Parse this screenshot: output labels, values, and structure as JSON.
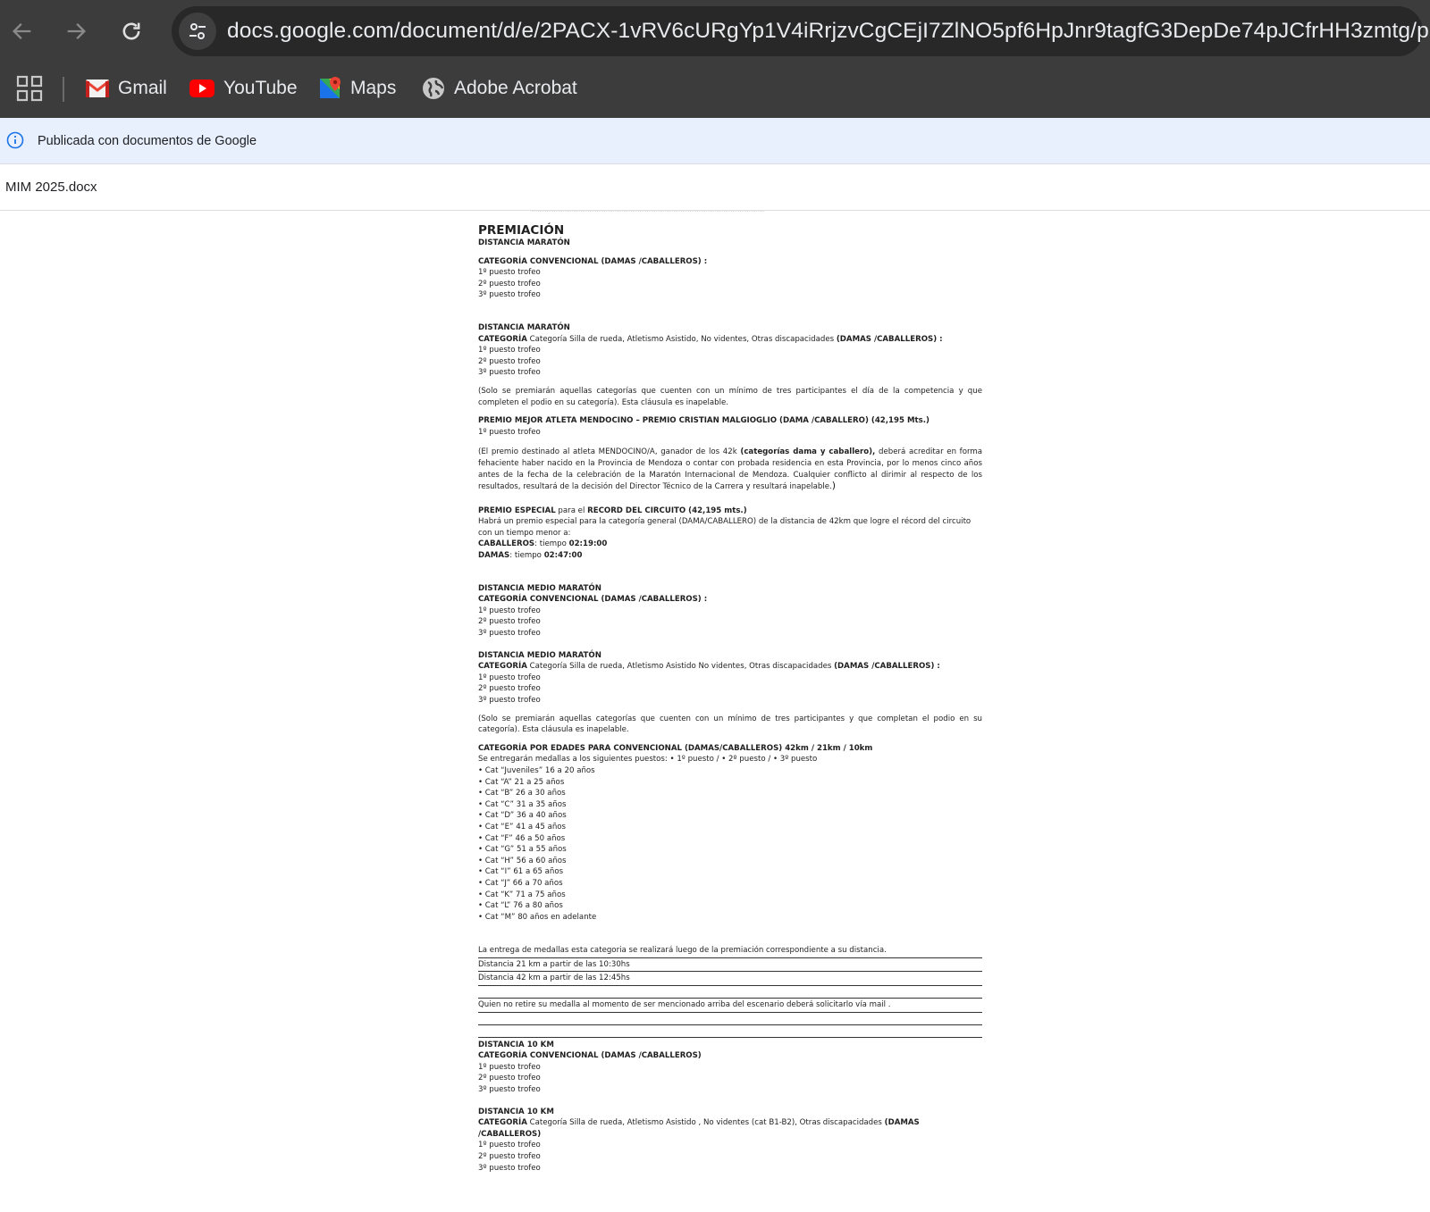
{
  "browser": {
    "url": "docs.google.com/document/d/e/2PACX-1vRV6cURgYp1V4iRrjzvCgCEjI7ZlNO5pf6HpJnr9tagfG3DepDe74pJCfrHH3zmtg/pub",
    "bookmarks": [
      {
        "label": "Gmail",
        "icon": "gmail-icon"
      },
      {
        "label": "YouTube",
        "icon": "youtube-icon"
      },
      {
        "label": "Maps",
        "icon": "maps-icon"
      },
      {
        "label": "Adobe Acrobat",
        "icon": "globe-icon"
      }
    ]
  },
  "banner": {
    "text": "Publicada con documentos de Google"
  },
  "doc_title": "MIM 2025.docx",
  "doc": {
    "heading": "PREMIACIÓN",
    "s1": {
      "title": "DISTANCIA MARATÓN",
      "cat": "CATEGORÍA CONVENCIONAL (DAMAS /CABALLEROS) :",
      "p1": "1º puesto trofeo",
      "p2": "2º puesto trofeo",
      "p3": "3º puesto trofeo"
    },
    "s2": {
      "title": "DISTANCIA MARATÓN",
      "cat_b1": "CATEGORÍA",
      "cat_text": " Categoría Silla de rueda, Atletismo Asistido, No videntes, Otras discapacidades ",
      "cat_b2": "(DAMAS /CABALLEROS) :",
      "p1": "1º puesto trofeo",
      "p2": "2º puesto trofeo",
      "p3": "3º puesto trofeo",
      "note": "(Solo se premiarán aquellas categorías que cuenten con un mínimo de tres participantes el día de la competencia y que completen el podio en su categoría). Esta cláusula es inapelable."
    },
    "s3": {
      "title": "PREMIO MEJOR ATLETA MENDOCINO – PREMIO CRISTIAN MALGIOGLIO  (DAMA /CABALLERO) (42,195 Mts.)",
      "p1": "1º puesto trofeo",
      "note_a": "(El premio destinado al atleta MENDOCINO/A,  ganador de los 42k ",
      "note_b": "(categorías dama y caballero),",
      "note_c": "  deberá acreditar en forma fehaciente haber nacido en la Provincia de Mendoza o contar con probada residencia en esta Provincia, por lo menos cinco años antes de la fecha de la celebración de la Maratón Internacional de Mendoza. Cualquier conflicto al dirimir al respecto de los resultados, resultará de la decisión del Director Técnico de la Carrera y resultará inapelable.",
      "note_end": ")"
    },
    "s4": {
      "title_b1": "PREMIO ESPECIAL",
      "title_text": " para el ",
      "title_b2": "RECORD DEL CIRCUITO (42,195 mts.)",
      "desc": "Habrá un premio especial para la categoría general (DAMA/CABALLERO) de la distancia de 42km que logre el récord del circuito con un tiempo menor a:",
      "men_label": "CABALLEROS",
      "men_text": ": tiempo ",
      "men_time": "02:19:00",
      "women_label": "DAMAS",
      "women_text": ": tiempo ",
      "women_time": "02:47:00"
    },
    "s5": {
      "title": "DISTANCIA MEDIO MARATÓN",
      "cat": "CATEGORÍA CONVENCIONAL (DAMAS /CABALLEROS) :",
      "p1": "1º puesto trofeo",
      "p2": "2º puesto trofeo",
      "p3": "3º puesto trofeo"
    },
    "s6": {
      "title": "DISTANCIA MEDIO MARATÓN",
      "cat_b1": "CATEGORÍA",
      "cat_text": " Categoría Silla de rueda, Atletismo Asistido No videntes, Otras discapacidades ",
      "cat_b2": "(DAMAS /CABALLEROS) :",
      "p1": "1º puesto trofeo",
      "p2": "2º puesto trofeo",
      "p3": "3º puesto trofeo",
      "note": "(Solo se premiarán aquellas categorías que cuenten con un mínimo de tres participantes y que completan el podio en su categoría). Esta cláusula es inapelable."
    },
    "s7": {
      "title": "CATEGORÍA POR EDADES PARA CONVENCIONAL (DAMAS/CABALLEROS) 42km / 21km / 10km",
      "intro": "Se entregarán medallas a los siguientes puestos: • 1º puesto / • 2º puesto  / • 3º puesto",
      "cats": [
        "• Cat “Juveniles” 16 a 20 años",
        "• Cat “A” 21 a 25 años",
        "• Cat “B” 26 a 30 años",
        "• Cat “C” 31 a 35 años",
        "• Cat “D” 36 a 40 años",
        "• Cat “E” 41 a 45 años",
        "• Cat “F” 46 a 50 años",
        "• Cat “G” 51 a 55 años",
        "• Cat “H” 56 a 60 años",
        "• Cat “I” 61 a 65 años",
        "• Cat “J” 66 a 70 años",
        "• Cat “K” 71 a 75 años",
        "• Cat “L” 76 a 80 años",
        "• Cat “M” 80 años en adelante"
      ]
    },
    "s8": {
      "line1": "La entrega de medallas esta categoria  se realizará luego de la premiación correspondiente a su distancia.",
      "line2": "Distancia 21 km a partir de las 10:30hs",
      "line3": "Distancia 42 km a partir de las 12:45hs",
      "line4": "Quien no retire su medalla al momento de ser mencionado arriba del escenario deberá solicitarlo vía mail ."
    },
    "s9": {
      "title": "DISTANCIA 10 KM",
      "cat": "CATEGORÍA CONVENCIONAL (DAMAS /CABALLEROS)",
      "p1": "1º puesto trofeo",
      "p2": "2º puesto trofeo",
      "p3": "3º puesto trofeo"
    },
    "s10": {
      "title": "DISTANCIA 10 KM",
      "cat_b1": "CATEGORÍA",
      "cat_text": " Categoría Silla de rueda, Atletismo Asistido , No videntes (cat B1-B2), Otras discapacidades ",
      "cat_b2": "(DAMAS /CABALLEROS)",
      "p1": "1º puesto trofeo",
      "p2": "2º puesto trofeo",
      "p3": "3º puesto trofeo"
    }
  }
}
